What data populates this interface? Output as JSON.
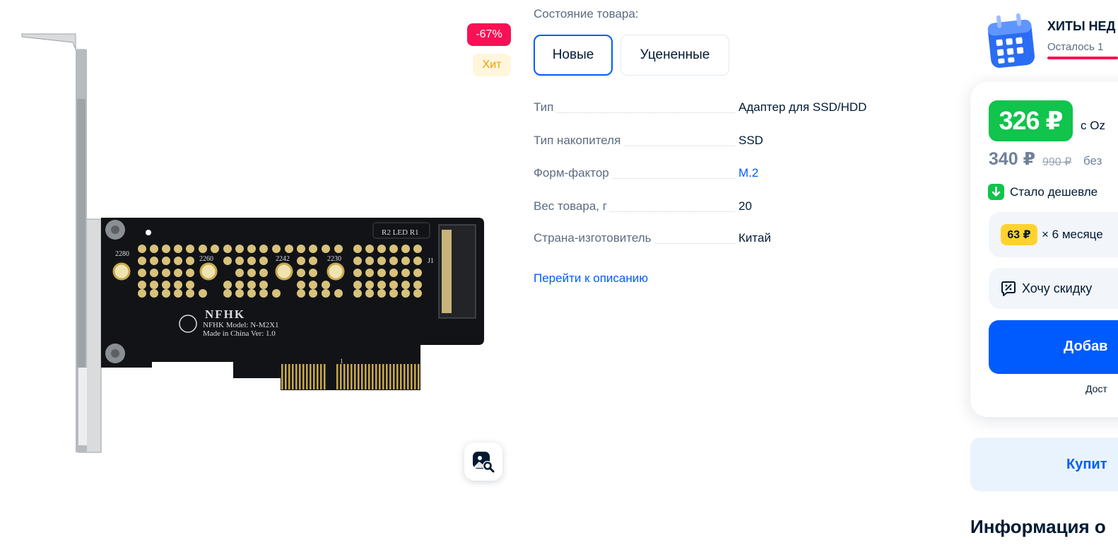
{
  "gallery": {
    "badge_discount": "-67%",
    "badge_hit": "Хит",
    "image_text": {
      "brand": "NFHK",
      "model_line": "NFHK Model: N-M2X1",
      "origin_line": "Made in China Ver: 1.0",
      "size_labels": [
        "2280",
        "2260",
        "2242",
        "2230"
      ],
      "led_label": "R2 LED R1",
      "connector_label": "J1",
      "pin_label": "1"
    },
    "zoom_icon": "search-image-icon"
  },
  "condition": {
    "title": "Состояние товара:",
    "options": [
      {
        "label": "Новые",
        "selected": true
      },
      {
        "label": "Уцененные",
        "selected": false
      }
    ]
  },
  "specs": [
    {
      "label": "Тип",
      "value": "Адаптер для SSD/HDD",
      "link": false
    },
    {
      "label": "Тип накопителя",
      "value": "SSD",
      "link": false
    },
    {
      "label": "Форм-фактор",
      "value": "M.2",
      "link": true
    },
    {
      "label": "Вес товара, г",
      "value": "20",
      "link": false
    },
    {
      "label": "Страна-изготовитель",
      "value": "Китай",
      "link": false
    }
  ],
  "description_link": "Перейти к описанию",
  "promo": {
    "title": "ХИТЫ НЕД",
    "subtitle": "Осталось 1",
    "icon": "calendar-icon"
  },
  "price": {
    "main": "326 ₽",
    "main_note": "с Oz",
    "secondary": "340 ₽",
    "old": "990 ₽",
    "without_note": "без",
    "cheaper_text": "Стало дешевле",
    "installment_price": "63 ₽",
    "installment_text": "× 6 месяце",
    "discount_text": "Хочу скидку",
    "add_button": "Добав",
    "delivery_text": "Дост",
    "buy_text": "Купит"
  },
  "info_heading": "Информация о",
  "colors": {
    "brand_blue": "#005bff",
    "price_green": "#10c44c",
    "discount_red": "#f91155",
    "hit_orange": "#f59a00",
    "installment_yellow": "#ffd32f"
  }
}
